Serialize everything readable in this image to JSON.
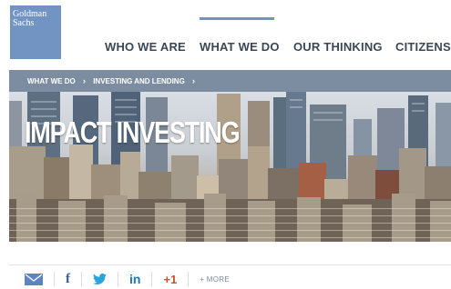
{
  "logo": {
    "line1": "Goldman",
    "line2": "Sachs"
  },
  "nav": {
    "items": [
      {
        "label": "WHO WE ARE"
      },
      {
        "label": "WHAT WE DO",
        "active": true
      },
      {
        "label": "OUR THINKING"
      },
      {
        "label": "CITIZENSH"
      }
    ]
  },
  "breadcrumb": {
    "items": [
      {
        "label": "WHAT WE DO"
      },
      {
        "label": "INVESTING AND LENDING"
      }
    ],
    "separator": "›"
  },
  "hero": {
    "title": "IMPACT INVESTING"
  },
  "share": {
    "email_icon": "envelope-icon",
    "facebook_label": "f",
    "twitter_icon": "twitter-bird-icon",
    "linkedin_label": "in",
    "googleplus_label": "+1",
    "more_label": "+ MORE"
  },
  "colors": {
    "brand_blue": "#7294c3",
    "breadcrumb_bg": "#7d8da1",
    "nav_text": "#3b4755"
  }
}
